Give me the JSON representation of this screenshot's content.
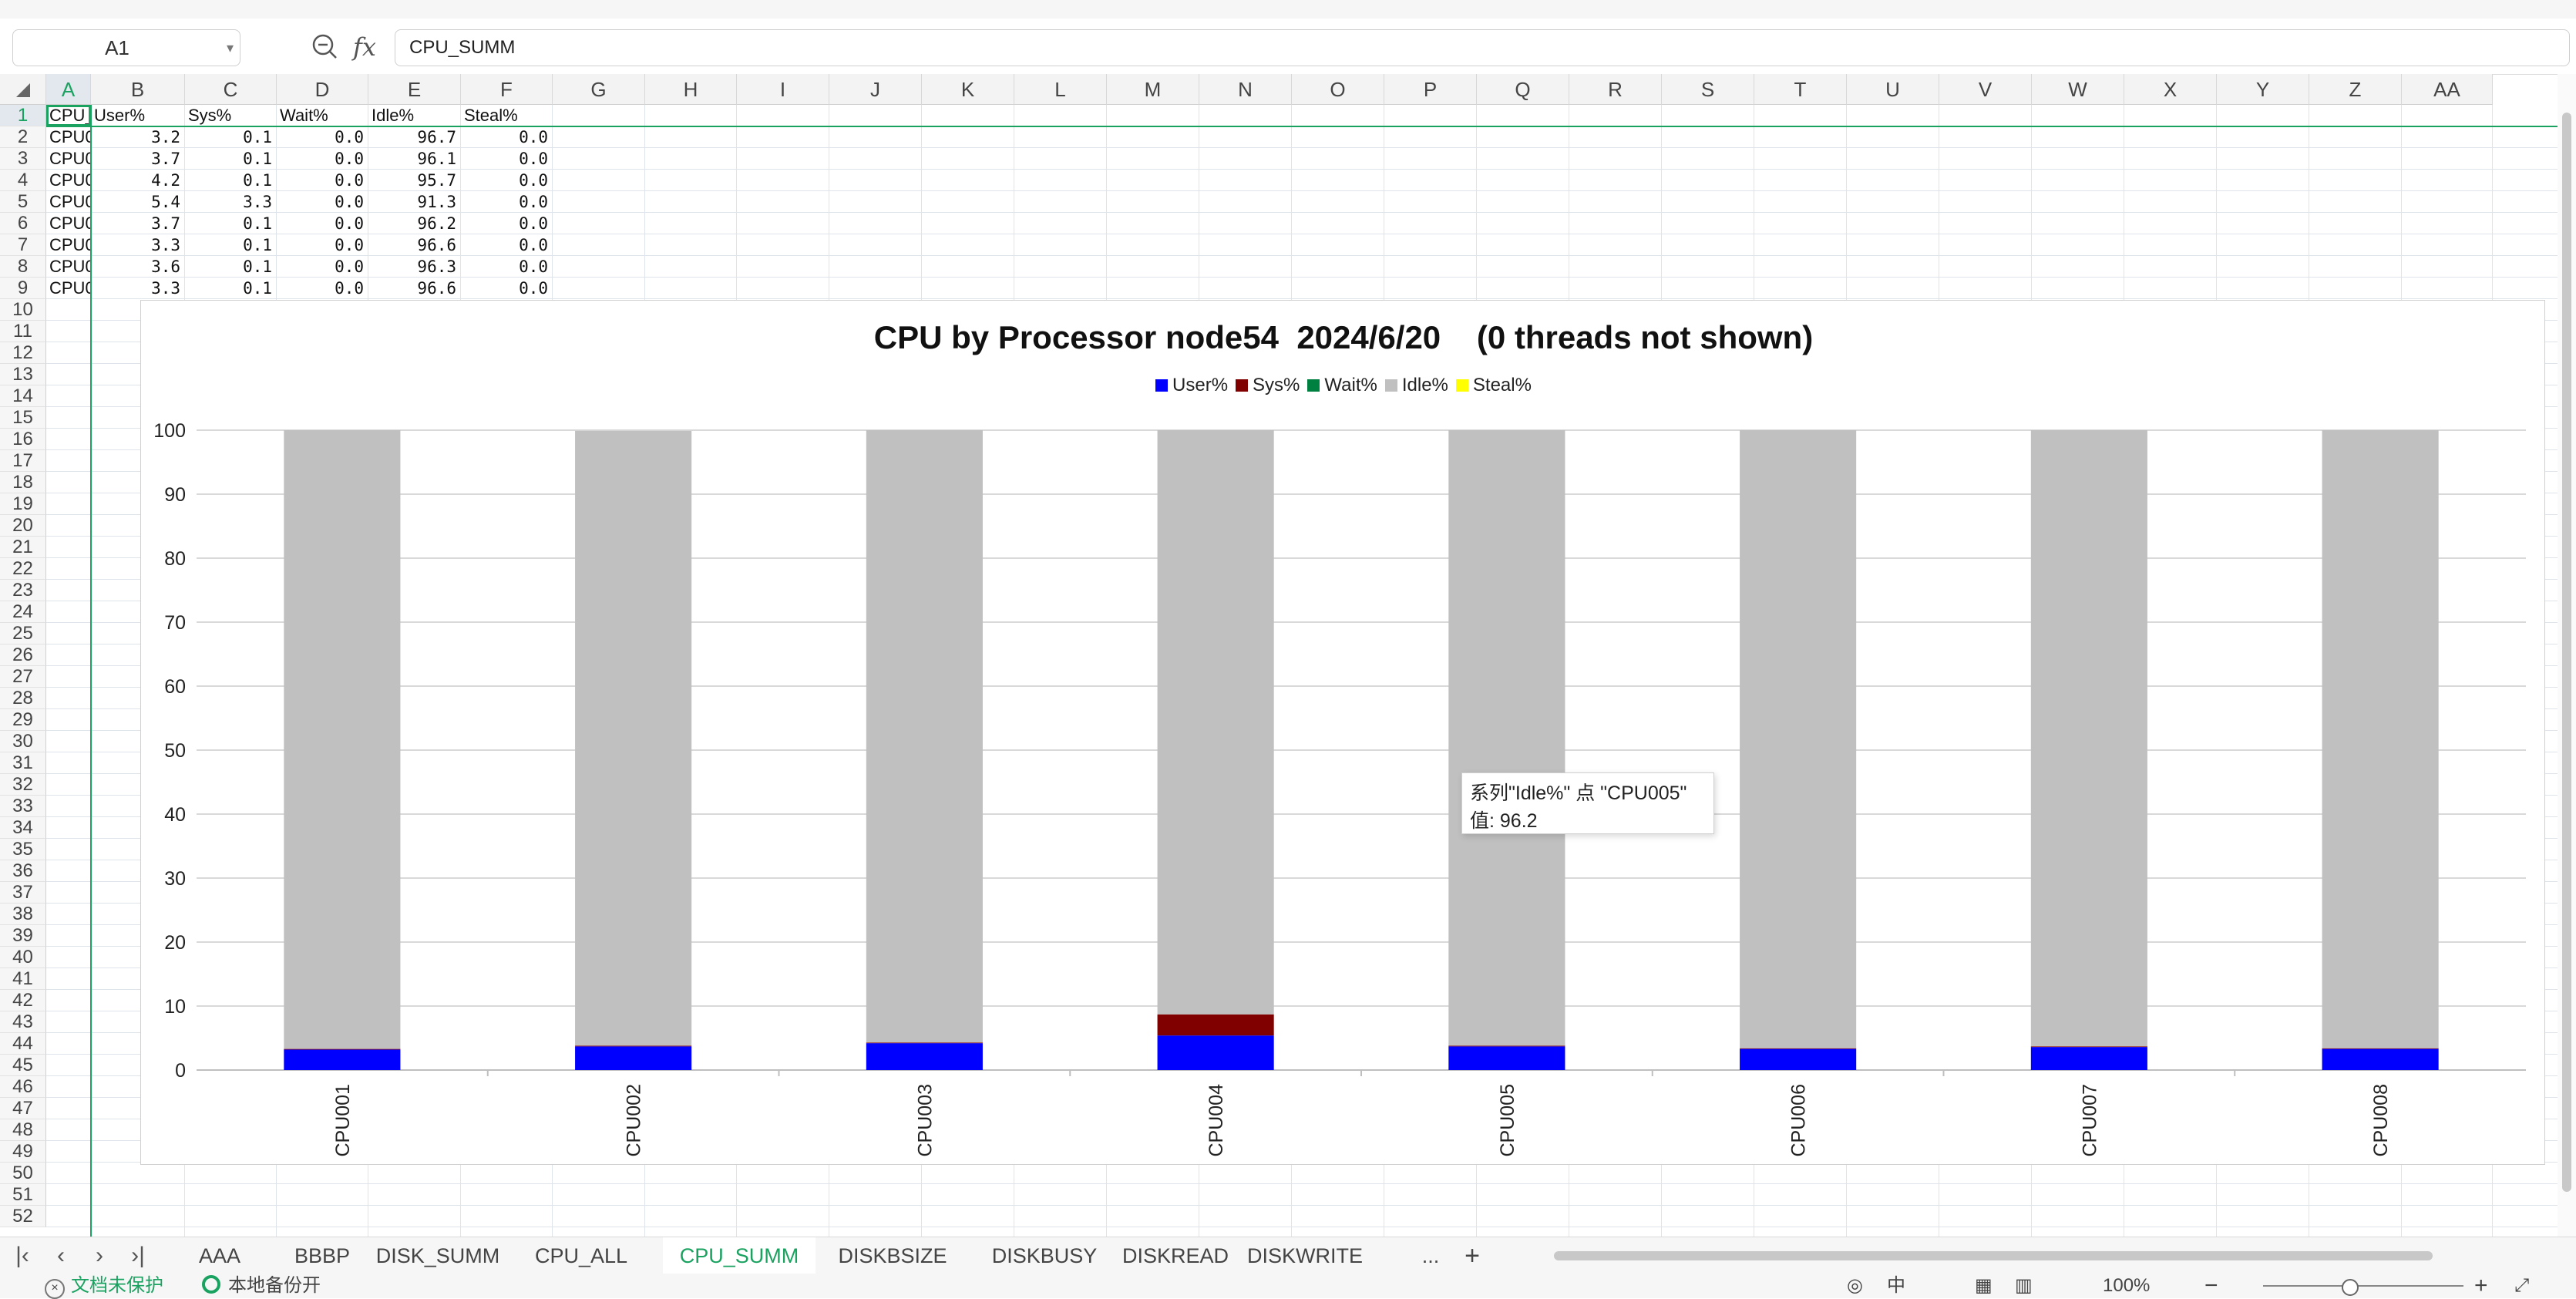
{
  "formula_bar": {
    "cell_ref": "A1",
    "fx_label": "fx",
    "content": "CPU_SUMM"
  },
  "columns": [
    "A",
    "B",
    "C",
    "D",
    "E",
    "F",
    "G",
    "H",
    "I",
    "J",
    "K",
    "L",
    "M",
    "N",
    "O",
    "P",
    "Q",
    "R",
    "S",
    "T",
    "U",
    "V",
    "W",
    "X",
    "Y",
    "Z",
    "AA"
  ],
  "rows": [
    "1",
    "2",
    "3",
    "4",
    "5",
    "6",
    "7",
    "8",
    "9",
    "10",
    "11",
    "12",
    "13",
    "14",
    "15",
    "16",
    "17",
    "18",
    "19",
    "20",
    "21",
    "22",
    "23",
    "24",
    "25",
    "26",
    "27",
    "28",
    "29",
    "30",
    "31",
    "32",
    "33",
    "34",
    "35",
    "36",
    "37",
    "38",
    "39",
    "40",
    "41",
    "42",
    "43",
    "44",
    "45",
    "46",
    "47",
    "48",
    "49",
    "50",
    "51",
    "52"
  ],
  "sheet": {
    "headers": [
      "CPU_SUMM",
      "User%",
      "Sys%",
      "Wait%",
      "Idle%",
      "Steal%"
    ],
    "data": [
      [
        "CPU001",
        "3.2",
        "0.1",
        "0.0",
        "96.7",
        "0.0"
      ],
      [
        "CPU002",
        "3.7",
        "0.1",
        "0.0",
        "96.1",
        "0.0"
      ],
      [
        "CPU003",
        "4.2",
        "0.1",
        "0.0",
        "95.7",
        "0.0"
      ],
      [
        "CPU004",
        "5.4",
        "3.3",
        "0.0",
        "91.3",
        "0.0"
      ],
      [
        "CPU005",
        "3.7",
        "0.1",
        "0.0",
        "96.2",
        "0.0"
      ],
      [
        "CPU006",
        "3.3",
        "0.1",
        "0.0",
        "96.6",
        "0.0"
      ],
      [
        "CPU007",
        "3.6",
        "0.1",
        "0.0",
        "96.3",
        "0.0"
      ],
      [
        "CPU008",
        "3.3",
        "0.1",
        "0.0",
        "96.6",
        "0.0"
      ]
    ]
  },
  "chart_data": {
    "type": "bar",
    "stacked": true,
    "title": "CPU by Processor node54  2024/6/20    (0 threads not shown)",
    "categories": [
      "CPU001",
      "CPU002",
      "CPU003",
      "CPU004",
      "CPU005",
      "CPU006",
      "CPU007",
      "CPU008"
    ],
    "series": [
      {
        "name": "User%",
        "color": "#0000ff",
        "values": [
          3.2,
          3.7,
          4.2,
          5.4,
          3.7,
          3.3,
          3.6,
          3.3
        ]
      },
      {
        "name": "Sys%",
        "color": "#800000",
        "values": [
          0.1,
          0.1,
          0.1,
          3.3,
          0.1,
          0.1,
          0.1,
          0.1
        ]
      },
      {
        "name": "Wait%",
        "color": "#008040",
        "values": [
          0.0,
          0.0,
          0.0,
          0.0,
          0.0,
          0.0,
          0.0,
          0.0
        ]
      },
      {
        "name": "Idle%",
        "color": "#c0c0c0",
        "values": [
          96.7,
          96.1,
          95.7,
          91.3,
          96.2,
          96.6,
          96.3,
          96.6
        ]
      },
      {
        "name": "Steal%",
        "color": "#ffff00",
        "values": [
          0.0,
          0.0,
          0.0,
          0.0,
          0.0,
          0.0,
          0.0,
          0.0
        ]
      }
    ],
    "ylim": [
      0,
      100
    ],
    "yticks": [
      "0",
      "10",
      "20",
      "30",
      "40",
      "50",
      "60",
      "70",
      "80",
      "90",
      "100"
    ],
    "legend": "top",
    "grid": true,
    "tooltip": {
      "line1": "系列\"Idle%\" 点 \"CPU005\"",
      "line2": "值: 96.2"
    }
  },
  "tabs": [
    "AAA",
    "BBBP",
    "DISK_SUMM",
    "CPU_ALL",
    "CPU_SUMM",
    "DISKBSIZE",
    "DISKBUSY",
    "DISKREAD",
    "DISKWRITE",
    "..."
  ],
  "active_tab": "CPU_SUMM",
  "tab_add": "+",
  "status": {
    "protect": "文档未保护",
    "backup": "本地备份开",
    "view_mode": "中",
    "zoom": "100%",
    "zoom_out": "−",
    "zoom_in": "+"
  },
  "colors": {
    "accent": "#1aa260",
    "gridline": "#dfe3ea",
    "selection": "#1aa260"
  }
}
